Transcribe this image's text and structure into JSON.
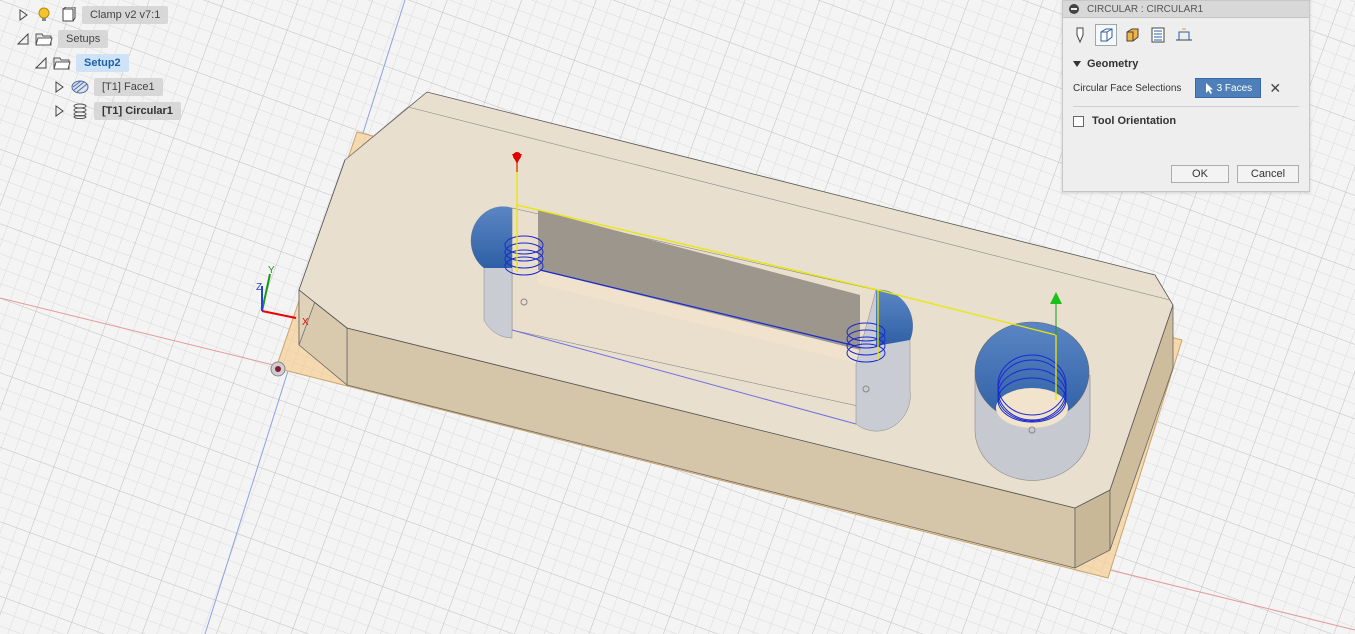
{
  "browser": {
    "root": {
      "label": "Clamp v2 v7:1"
    },
    "setups": {
      "label": "Setups"
    },
    "setup2": {
      "label": "Setup2"
    },
    "face1": {
      "label": "[T1] Face1"
    },
    "circular1": {
      "label": "[T1] Circular1"
    }
  },
  "dialog": {
    "title": "CIRCULAR : CIRCULAR1",
    "tabs": [
      "tool-tab",
      "geometry-tab",
      "heights-tab",
      "passes-tab",
      "linking-tab"
    ],
    "active_tab": "geometry-tab",
    "geometry": {
      "header": "Geometry",
      "circular_face_label": "Circular Face Selections",
      "selection_value": "3 Faces",
      "tool_orientation_label": "Tool Orientation",
      "tool_orientation_checked": false
    },
    "ok_label": "OK",
    "cancel_label": "Cancel"
  },
  "viewport": {
    "triad": {
      "x": "X",
      "y": "Y",
      "z": "Z"
    },
    "colors": {
      "grid_minor": "#d9d9d9",
      "grid_major": "#c4c4c4",
      "part_top": "#e8dfd0",
      "part_side": "#d6c6ad",
      "bore_blue": "#4a78b8",
      "toolpath_blue": "#1a2ad0",
      "toolpath_yellow": "#e8e800",
      "stock_orange": "#f5d9b0"
    }
  }
}
